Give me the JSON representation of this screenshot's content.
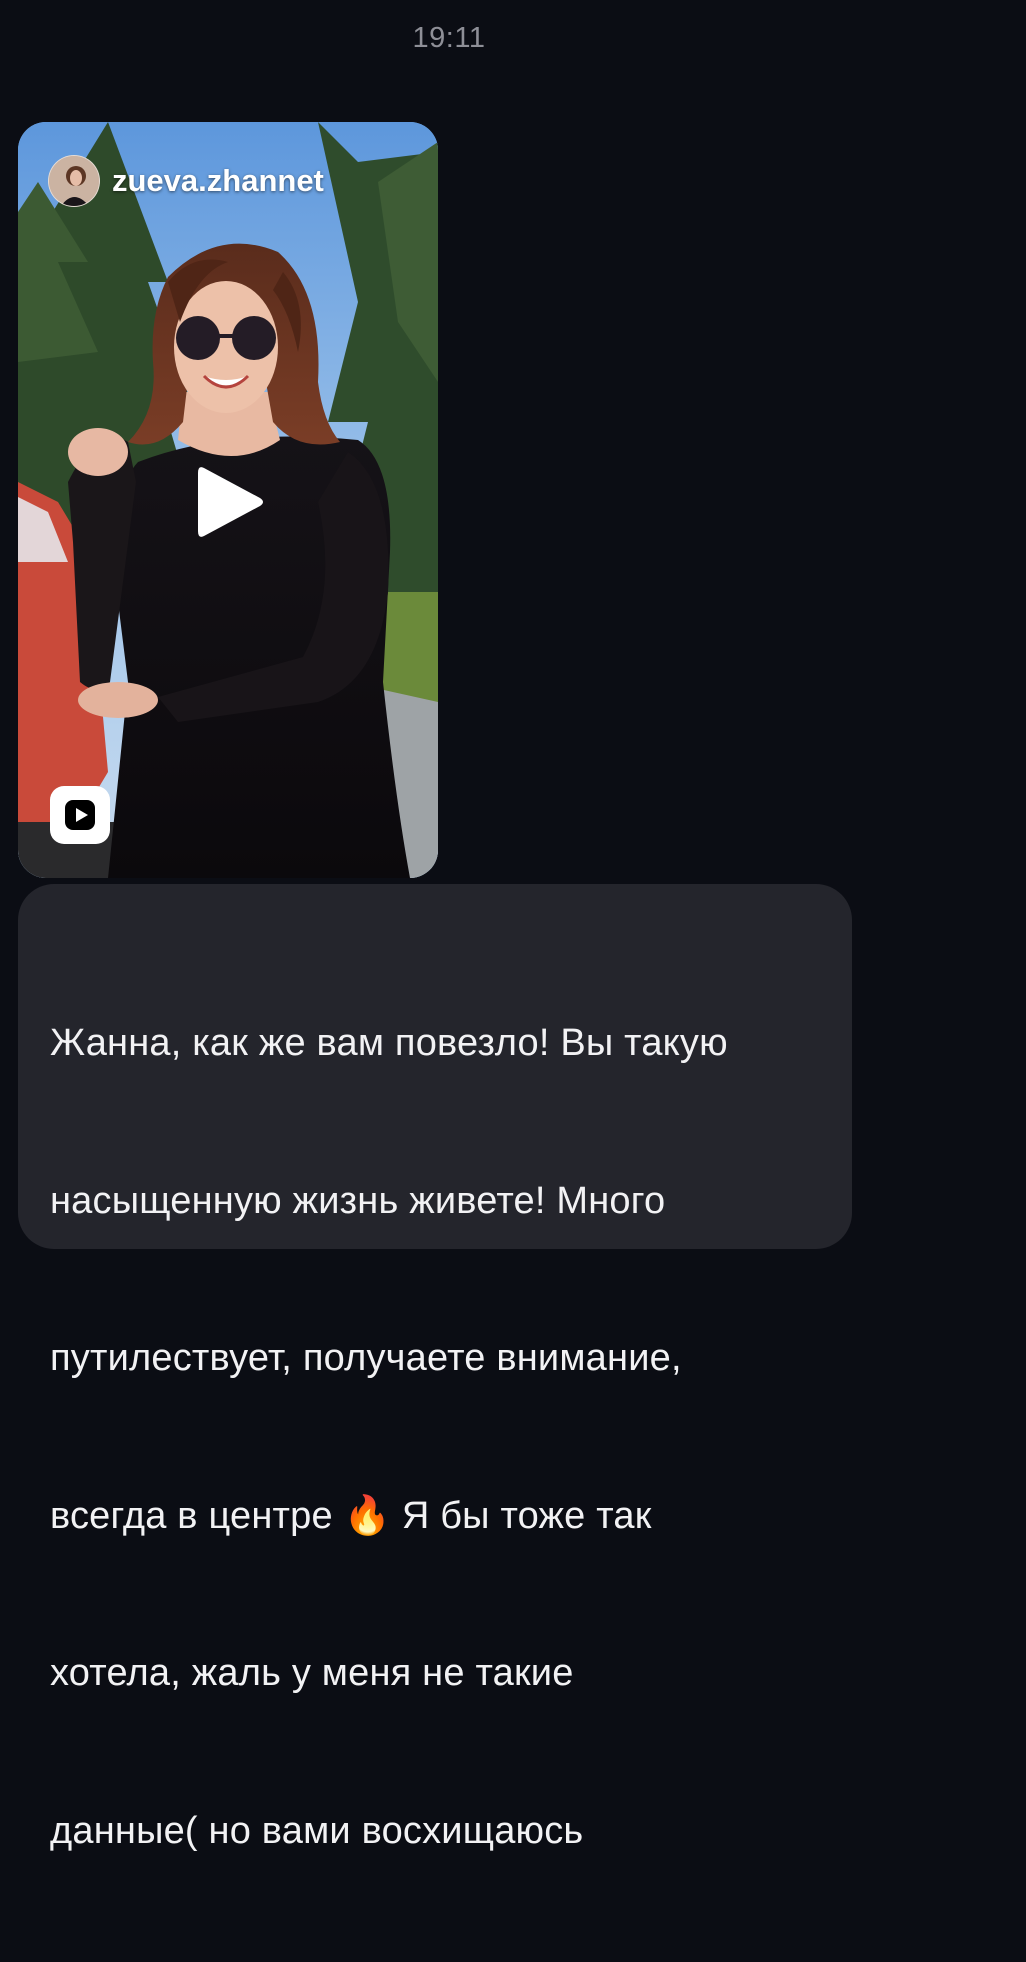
{
  "chat": {
    "timestamp": "19:11"
  },
  "shared_reel": {
    "username": "zueva.zhannet",
    "avatar_icon": "profile-avatar",
    "center_icon": "play-icon",
    "badge_icon": "reels-icon"
  },
  "message": {
    "lines": [
      "Жанна, как же вам повезло! Вы такую",
      "насыщенную жизнь живете! Много",
      "путилествует, получаете внимание,",
      "всегда в центре 🔥 Я бы тоже так",
      "хотела, жаль у меня не такие",
      "данные( но вами восхищаюсь"
    ]
  },
  "colors": {
    "background": "#0b0d14",
    "bubble": "#24252c",
    "timestamp": "#8e8f97"
  }
}
